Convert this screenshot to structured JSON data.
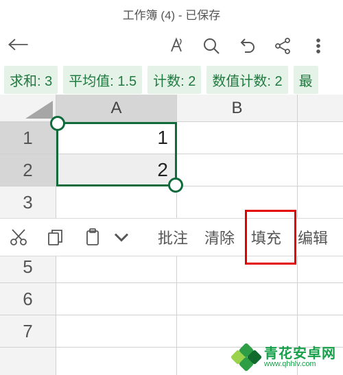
{
  "header": {
    "title": "工作簿 (4) - 已保存"
  },
  "stats": {
    "sum": "求和: 3",
    "avg": "平均值: 1.5",
    "count": "计数: 2",
    "ncount": "数值计数: 2",
    "more": "最"
  },
  "columns": {
    "A": "A",
    "B": "B"
  },
  "rows": {
    "r1": "1",
    "r2": "2",
    "r3": "3",
    "r5": "5",
    "r6": "6",
    "r7": "7"
  },
  "cells": {
    "A1": "1",
    "A2": "2"
  },
  "context_toolbar": {
    "annotate": "批注",
    "clear": "清除",
    "fill": "填充",
    "edit": "编辑"
  },
  "watermark": {
    "cn": "青花安卓网",
    "url": "www.qhhlv.com"
  },
  "colors": {
    "accent_green": "#0f6b3a",
    "highlight_red": "#e20000",
    "stat_bg": "#e5f2e8",
    "stat_fg": "#1f7a3f"
  }
}
